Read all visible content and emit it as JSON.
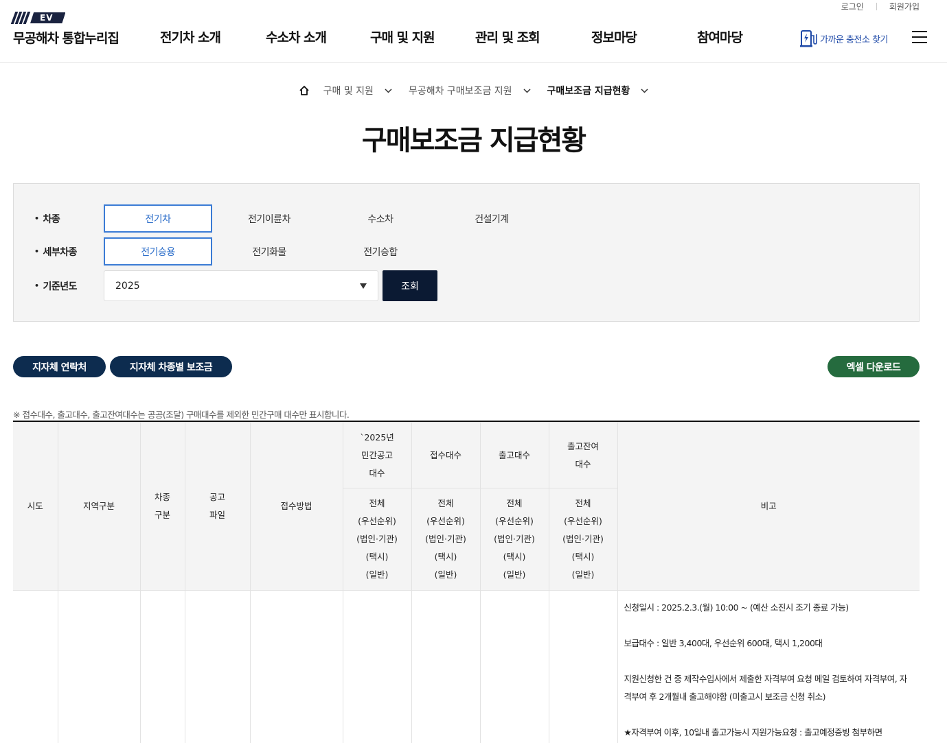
{
  "header": {
    "util_links": [
      "로그인",
      "회원가입"
    ],
    "logo_badge": "EV",
    "logo_text": "무공해차 통합누리집",
    "menu": [
      "전기차 소개",
      "수소차 소개",
      "구매 및 지원",
      "관리 및 조회",
      "정보마당",
      "참여마당"
    ],
    "charger_link": "가까운 충전소 찾기"
  },
  "breadcrumb": [
    "구매 및 지원",
    "무공해차 구매보조금 지원",
    "구매보조금 지급현황"
  ],
  "page_title": "구매보조금 지급현황",
  "filter": {
    "vehicle_type": {
      "label": "차종",
      "options": [
        "전기차",
        "전기이륜차",
        "수소차",
        "건설기계"
      ],
      "selected": "전기차"
    },
    "sub_type": {
      "label": "세부차종",
      "options": [
        "전기승용",
        "전기화물",
        "전기승합"
      ],
      "selected": "전기승용"
    },
    "year": {
      "label": "기준년도",
      "value": "2025"
    },
    "search_button": "조회"
  },
  "actions": {
    "contacts": "지자체 연락처",
    "subsidy_by_type": "지자체 차종별 보조금",
    "excel": "엑셀 다운로드"
  },
  "notice": "※ 접수대수, 출고대수, 출고잔여대수는 공공(조달) 구매대수를 제외한 민간구매 대수만 표시합니다.",
  "table": {
    "headers": {
      "sido": "시도",
      "region": "지역구분",
      "vehicle_type": [
        "차종",
        "구분"
      ],
      "notice_file": [
        "공고",
        "파일"
      ],
      "method": "접수방법",
      "announced": [
        "`2025년",
        "민간공고",
        "대수"
      ],
      "received": "접수대수",
      "released": "출고대수",
      "remaining": [
        "출고잔여",
        "대수"
      ],
      "remark": "비고",
      "sub_lines": [
        "전체",
        "(우선순위)",
        "(법인·기관)",
        "(택시)",
        "(일반)"
      ]
    },
    "rows": [
      {
        "sido": "",
        "region": "",
        "vehicle_type": "",
        "notice_file": "",
        "method": "",
        "announced": "",
        "received": "",
        "released": "",
        "remaining": "",
        "remark": [
          "신청일시 : 2025.2.3.(월) 10:00 ~ (예산 소진시 조기 종료 가능)",
          "보급대수 : 일반 3,400대, 우선순위 600대, 택시 1,200대",
          "지원신청한 건 중 제작수입사에서 제출한 자격부여 요청 메일 검토하여 자격부여, 자격부여 후 2개월내 출고해야함 (미출고시 보조금 신청 취소)",
          "★자격부여 이후, 10일내 출고가능시 지원가능요청 : 출고예정증빙 첨부하면"
        ]
      }
    ]
  }
}
